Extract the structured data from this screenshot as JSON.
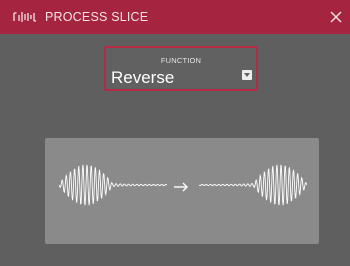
{
  "dialog": {
    "title": "PROCESS SLICE",
    "app_icon": "waveform-logo-icon",
    "close_icon": "close-icon"
  },
  "function": {
    "label": "FUNCTION",
    "value": "Reverse",
    "dropdown_icon": "chevron-down-icon"
  },
  "preview": {
    "original_waveform": "waveform-icon",
    "arrow": "arrow-right-icon",
    "result_waveform": "reversed-waveform-icon"
  },
  "colors": {
    "titlebar": "#a5243f",
    "accent_border": "#b52a45",
    "background": "#5f5f5f",
    "panel": "#8a8a8a"
  }
}
